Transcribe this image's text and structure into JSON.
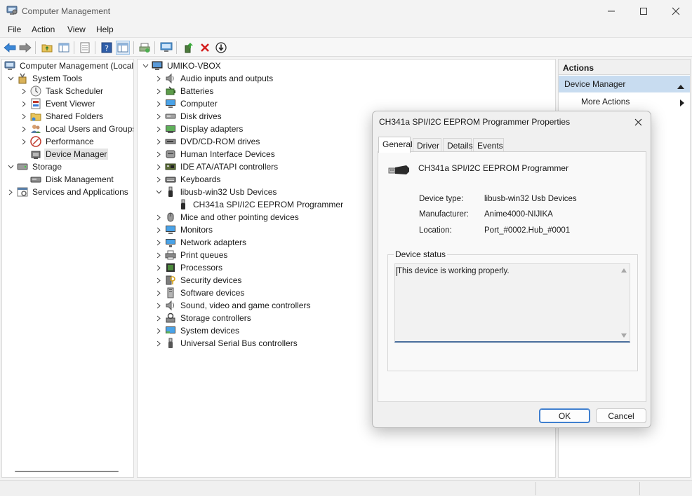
{
  "window": {
    "title": "Computer Management"
  },
  "menu": [
    "File",
    "Action",
    "View",
    "Help"
  ],
  "left_tree": {
    "root": "Computer Management (Local",
    "items": [
      {
        "label": "System Tools",
        "icon": "tools-icon",
        "level": 1,
        "chevron": "down"
      },
      {
        "label": "Task Scheduler",
        "icon": "clock-icon",
        "level": 2,
        "chevron": "right"
      },
      {
        "label": "Event Viewer",
        "icon": "event-viewer-icon",
        "level": 2,
        "chevron": "right"
      },
      {
        "label": "Shared Folders",
        "icon": "shared-folder-icon",
        "level": 2,
        "chevron": "right"
      },
      {
        "label": "Local Users and Groups",
        "icon": "users-icon",
        "level": 2,
        "chevron": "right"
      },
      {
        "label": "Performance",
        "icon": "performance-icon",
        "level": 2,
        "chevron": "right"
      },
      {
        "label": "Device Manager",
        "icon": "device-manager-icon",
        "level": 2,
        "chevron": "none",
        "selected": true
      },
      {
        "label": "Storage",
        "icon": "storage-icon",
        "level": 1,
        "chevron": "down"
      },
      {
        "label": "Disk Management",
        "icon": "disk-management-icon",
        "level": 2,
        "chevron": "none"
      },
      {
        "label": "Services and Applications",
        "icon": "services-icon",
        "level": 1,
        "chevron": "right"
      }
    ]
  },
  "device_tree": {
    "root": "UMIKO-VBOX",
    "categories": [
      {
        "label": "Audio inputs and outputs",
        "icon": "speaker-icon",
        "chevron": "right"
      },
      {
        "label": "Batteries",
        "icon": "battery-icon",
        "chevron": "right"
      },
      {
        "label": "Computer",
        "icon": "computer-icon",
        "chevron": "right"
      },
      {
        "label": "Disk drives",
        "icon": "disk-drive-icon",
        "chevron": "right"
      },
      {
        "label": "Display adapters",
        "icon": "display-adapter-icon",
        "chevron": "right"
      },
      {
        "label": "DVD/CD-ROM drives",
        "icon": "dvd-icon",
        "chevron": "right"
      },
      {
        "label": "Human Interface Devices",
        "icon": "hid-icon",
        "chevron": "right"
      },
      {
        "label": "IDE ATA/ATAPI controllers",
        "icon": "ide-controller-icon",
        "chevron": "right"
      },
      {
        "label": "Keyboards",
        "icon": "keyboard-icon",
        "chevron": "right"
      },
      {
        "label": "libusb-win32 Usb Devices",
        "icon": "usb-plug-icon",
        "chevron": "down"
      },
      {
        "label": "CH341a SPI/I2C EEPROM Programmer",
        "icon": "usb-plug-icon",
        "chevron": "none",
        "child": true
      },
      {
        "label": "Mice and other pointing devices",
        "icon": "mouse-icon",
        "chevron": "right"
      },
      {
        "label": "Monitors",
        "icon": "monitor-icon",
        "chevron": "right"
      },
      {
        "label": "Network adapters",
        "icon": "network-icon",
        "chevron": "right"
      },
      {
        "label": "Print queues",
        "icon": "printer-icon",
        "chevron": "right"
      },
      {
        "label": "Processors",
        "icon": "processor-icon",
        "chevron": "right"
      },
      {
        "label": "Security devices",
        "icon": "security-icon",
        "chevron": "right"
      },
      {
        "label": "Software devices",
        "icon": "software-device-icon",
        "chevron": "right"
      },
      {
        "label": "Sound, video and game controllers",
        "icon": "sound-icon",
        "chevron": "right"
      },
      {
        "label": "Storage controllers",
        "icon": "storage-controller-icon",
        "chevron": "right"
      },
      {
        "label": "System devices",
        "icon": "system-devices-icon",
        "chevron": "right"
      },
      {
        "label": "Universal Serial Bus controllers",
        "icon": "usb-icon",
        "chevron": "right"
      }
    ]
  },
  "actions": {
    "header": "Actions",
    "section": "Device Manager",
    "more": "More Actions"
  },
  "dialog": {
    "title": "CH341a SPI/I2C EEPROM Programmer Properties",
    "tabs": [
      "General",
      "Driver",
      "Details",
      "Events"
    ],
    "device_name": "CH341a SPI/I2C EEPROM Programmer",
    "props": [
      {
        "label": "Device type:",
        "value": "libusb-win32 Usb Devices"
      },
      {
        "label": "Manufacturer:",
        "value": "Anime4000-NIJIKA"
      },
      {
        "label": "Location:",
        "value": "Port_#0002.Hub_#0001"
      }
    ],
    "status_group_label": "Device status",
    "status_text": "This device is working properly.",
    "ok_label": "OK",
    "cancel_label": "Cancel"
  },
  "colors": {
    "accent": "#3f7fcf",
    "selection": "#e5e5e5",
    "actions_section": "#c8dcf0"
  }
}
